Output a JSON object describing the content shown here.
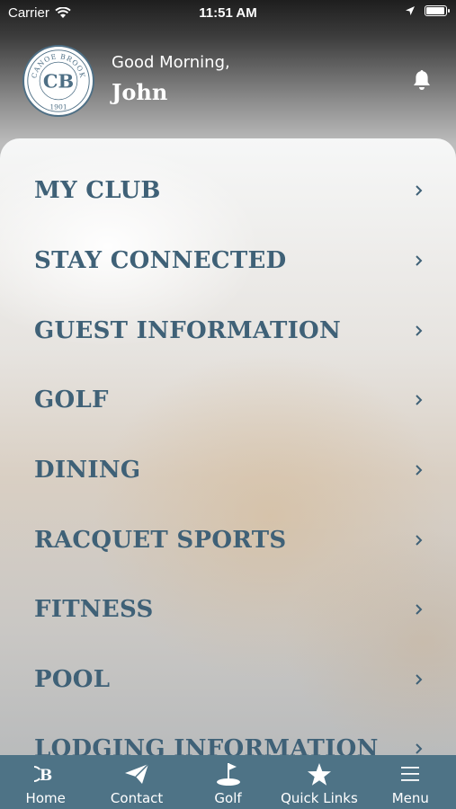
{
  "status_bar": {
    "carrier": "Carrier",
    "time": "11:51 AM",
    "battery_level": 0.95
  },
  "header": {
    "greeting": "Good Morning,",
    "user_name": "John",
    "logo": {
      "ring_text_top": "CANOE BROOK",
      "monogram": "CB",
      "ring_text_bottom": "1901"
    }
  },
  "menu": {
    "items": [
      {
        "label": "MY CLUB"
      },
      {
        "label": "STAY CONNECTED"
      },
      {
        "label": "GUEST INFORMATION"
      },
      {
        "label": "GOLF"
      },
      {
        "label": "DINING"
      },
      {
        "label": "RACQUET SPORTS"
      },
      {
        "label": "FITNESS"
      },
      {
        "label": "POOL"
      },
      {
        "label": "LODGING INFORMATION"
      }
    ]
  },
  "tab_bar": {
    "tabs": [
      {
        "label": "Home",
        "icon": "club-logo-icon"
      },
      {
        "label": "Contact",
        "icon": "paper-plane-icon"
      },
      {
        "label": "Golf",
        "icon": "golf-flag-icon"
      },
      {
        "label": "Quick Links",
        "icon": "star-icon"
      },
      {
        "label": "Menu",
        "icon": "hamburger-icon"
      }
    ]
  },
  "colors": {
    "accent": "#3f6177",
    "tab_bar": "#4e7386",
    "text_light": "#ffffff"
  }
}
